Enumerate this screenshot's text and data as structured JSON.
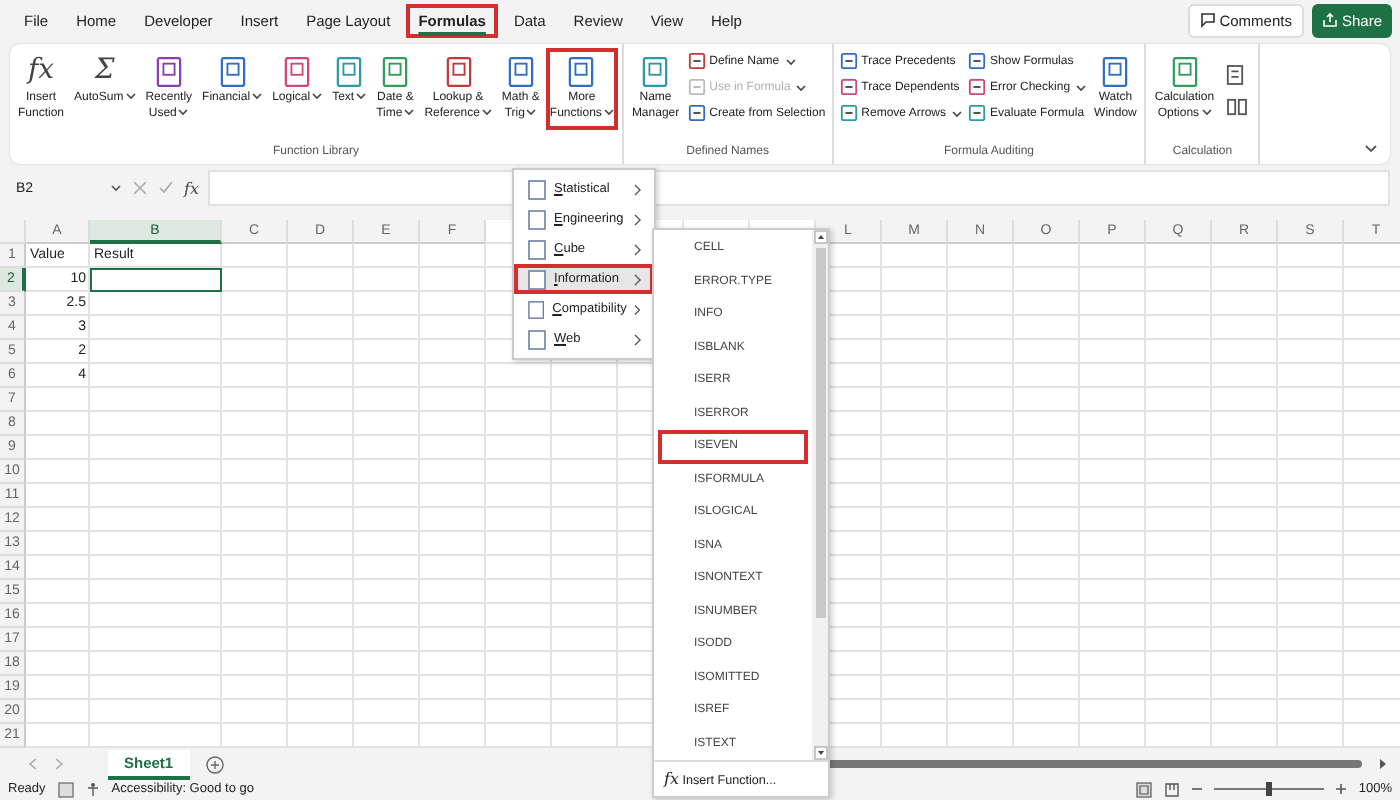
{
  "tabs": [
    {
      "label": "File",
      "selected": false,
      "highlighted": false
    },
    {
      "label": "Home",
      "selected": false,
      "highlighted": false
    },
    {
      "label": "Developer",
      "selected": false,
      "highlighted": false
    },
    {
      "label": "Insert",
      "selected": false,
      "highlighted": false
    },
    {
      "label": "Page Layout",
      "selected": false,
      "highlighted": false
    },
    {
      "label": "Formulas",
      "selected": true,
      "highlighted": true
    },
    {
      "label": "Data",
      "selected": false,
      "highlighted": false
    },
    {
      "label": "Review",
      "selected": false,
      "highlighted": false
    },
    {
      "label": "View",
      "selected": false,
      "highlighted": false
    },
    {
      "label": "Help",
      "selected": false,
      "highlighted": false
    }
  ],
  "header_buttons": [
    {
      "kind": "comments",
      "label": "Comments"
    },
    {
      "kind": "share",
      "label": "Share"
    }
  ],
  "ribbon": {
    "groups": [
      {
        "label": "Function Library",
        "items": [
          {
            "kind": "large",
            "lines": [
              "Insert",
              "Function"
            ],
            "glyph": "fx",
            "dropdown": false,
            "highlighted": false
          },
          {
            "kind": "large",
            "lines": [
              "AutoSum"
            ],
            "glyph": "Σ",
            "dropdown": true,
            "highlighted": false
          },
          {
            "kind": "large",
            "lines": [
              "Recently",
              "Used"
            ],
            "dropdown": true,
            "highlighted": false
          },
          {
            "kind": "large",
            "lines": [
              "Financial"
            ],
            "dropdown": true,
            "highlighted": false
          },
          {
            "kind": "large",
            "lines": [
              "Logical"
            ],
            "dropdown": true,
            "highlighted": false
          },
          {
            "kind": "large",
            "lines": [
              "Text"
            ],
            "dropdown": true,
            "highlighted": false
          },
          {
            "kind": "large",
            "lines": [
              "Date &",
              "Time"
            ],
            "dropdown": true,
            "highlighted": false
          },
          {
            "kind": "large",
            "lines": [
              "Lookup &",
              "Reference"
            ],
            "dropdown": true,
            "highlighted": false
          },
          {
            "kind": "large",
            "lines": [
              "Math &",
              "Trig"
            ],
            "dropdown": true,
            "highlighted": false
          },
          {
            "kind": "large",
            "lines": [
              "More",
              "Functions"
            ],
            "dropdown": true,
            "highlighted": true
          }
        ]
      },
      {
        "label": "Defined Names",
        "items": [
          {
            "kind": "large",
            "lines": [
              "Name",
              "Manager"
            ],
            "dropdown": false,
            "highlighted": false
          },
          {
            "kind": "column",
            "buttons": [
              {
                "label": "Define Name",
                "dropdown": true,
                "disabled": false
              },
              {
                "label": "Use in Formula",
                "dropdown": true,
                "disabled": true
              },
              {
                "label": "Create from Selection",
                "dropdown": false,
                "disabled": false
              }
            ]
          }
        ]
      },
      {
        "label": "Formula Auditing",
        "items": [
          {
            "kind": "column",
            "buttons": [
              {
                "label": "Trace Precedents",
                "dropdown": false,
                "disabled": false
              },
              {
                "label": "Trace Dependents",
                "dropdown": false,
                "disabled": false
              },
              {
                "label": "Remove Arrows",
                "dropdown": true,
                "disabled": false
              }
            ]
          },
          {
            "kind": "column",
            "buttons": [
              {
                "label": "Show Formulas",
                "dropdown": false,
                "disabled": false
              },
              {
                "label": "Error Checking",
                "dropdown": true,
                "disabled": false
              },
              {
                "label": "Evaluate Formula",
                "dropdown": false,
                "disabled": false
              }
            ]
          },
          {
            "kind": "large",
            "lines": [
              "Watch",
              "Window"
            ],
            "dropdown": false,
            "highlighted": false
          }
        ]
      },
      {
        "label": "Calculation",
        "items": [
          {
            "kind": "large",
            "lines": [
              "Calculation",
              "Options"
            ],
            "dropdown": true,
            "highlighted": false
          },
          {
            "kind": "icons"
          }
        ]
      }
    ]
  },
  "formula_bar": {
    "name_box": "B2",
    "glyph": "fx"
  },
  "sheet": {
    "columns": [
      {
        "label": "A",
        "selected": false
      },
      {
        "label": "B",
        "selected": true
      },
      {
        "label": "C",
        "selected": false
      },
      {
        "label": "D",
        "selected": false
      },
      {
        "label": "E",
        "selected": false
      },
      {
        "label": "F",
        "selected": false
      }
    ],
    "columns_right": [
      {
        "label": "L",
        "selected": false
      },
      {
        "label": "M",
        "selected": false
      },
      {
        "label": "N",
        "selected": false
      },
      {
        "label": "O",
        "selected": false
      },
      {
        "label": "P",
        "selected": false
      },
      {
        "label": "Q",
        "selected": false
      },
      {
        "label": "R",
        "selected": false
      },
      {
        "label": "S",
        "selected": false
      },
      {
        "label": "T",
        "selected": false
      }
    ],
    "rows": [
      {
        "label": "1",
        "selected": false,
        "cells": [
          {
            "kind": "text",
            "text": "Value",
            "selected": false
          },
          {
            "kind": "text",
            "text": "Result",
            "selected": false
          }
        ]
      },
      {
        "label": "2",
        "selected": true,
        "cells": [
          {
            "kind": "number",
            "text": "10",
            "selected": false
          },
          {
            "kind": "empty",
            "selected": true
          }
        ]
      },
      {
        "label": "3",
        "selected": false,
        "cells": [
          {
            "kind": "number",
            "text": "2.5",
            "selected": false
          }
        ]
      },
      {
        "label": "4",
        "selected": false,
        "cells": [
          {
            "kind": "number",
            "text": "3",
            "selected": false
          }
        ]
      },
      {
        "label": "5",
        "selected": false,
        "cells": [
          {
            "kind": "number",
            "text": "2",
            "selected": false
          }
        ]
      },
      {
        "label": "6",
        "selected": false,
        "cells": [
          {
            "kind": "number",
            "text": "4",
            "selected": false
          }
        ]
      },
      {
        "label": "7",
        "selected": false
      },
      {
        "label": "8",
        "selected": false
      },
      {
        "label": "9",
        "selected": false
      },
      {
        "label": "10",
        "selected": false
      },
      {
        "label": "11",
        "selected": false
      },
      {
        "label": "12",
        "selected": false
      },
      {
        "label": "13",
        "selected": false
      },
      {
        "label": "14",
        "selected": false
      },
      {
        "label": "15",
        "selected": false
      },
      {
        "label": "16",
        "selected": false
      },
      {
        "label": "17",
        "selected": false
      },
      {
        "label": "18",
        "selected": false
      },
      {
        "label": "19",
        "selected": false
      },
      {
        "label": "20",
        "selected": false
      },
      {
        "label": "21",
        "selected": false
      }
    ]
  },
  "more_functions_menu": [
    {
      "label": "Statistical",
      "highlighted": false
    },
    {
      "label": "Engineering",
      "highlighted": false
    },
    {
      "label": "Cube",
      "highlighted": false
    },
    {
      "label": "Information",
      "highlighted": true
    },
    {
      "label": "Compatibility",
      "highlighted": false
    },
    {
      "label": "Web",
      "highlighted": false
    }
  ],
  "information_menu": {
    "items": [
      {
        "label": "CELL",
        "highlighted": false
      },
      {
        "label": "ERROR.TYPE",
        "highlighted": false
      },
      {
        "label": "INFO",
        "highlighted": false
      },
      {
        "label": "ISBLANK",
        "highlighted": false
      },
      {
        "label": "ISERR",
        "highlighted": false
      },
      {
        "label": "ISERROR",
        "highlighted": false
      },
      {
        "label": "ISEVEN",
        "highlighted": true
      },
      {
        "label": "ISFORMULA",
        "highlighted": false
      },
      {
        "label": "ISLOGICAL",
        "highlighted": false
      },
      {
        "label": "ISNA",
        "highlighted": false
      },
      {
        "label": "ISNONTEXT",
        "highlighted": false
      },
      {
        "label": "ISNUMBER",
        "highlighted": false
      },
      {
        "label": "ISODD",
        "highlighted": false
      },
      {
        "label": "ISOMITTED",
        "highlighted": false
      },
      {
        "label": "ISREF",
        "highlighted": false
      },
      {
        "label": "ISTEXT",
        "highlighted": false
      }
    ],
    "footer": {
      "glyph": "fx",
      "label": "Insert Function..."
    }
  },
  "sheet_tabs": [
    {
      "label": "Sheet1",
      "selected": true
    }
  ],
  "status_bar": {
    "status": "Ready",
    "accessibility": "Accessibility: Good to go",
    "zoom_slider": {
      "level": 0.5
    },
    "zoom": "100%"
  }
}
